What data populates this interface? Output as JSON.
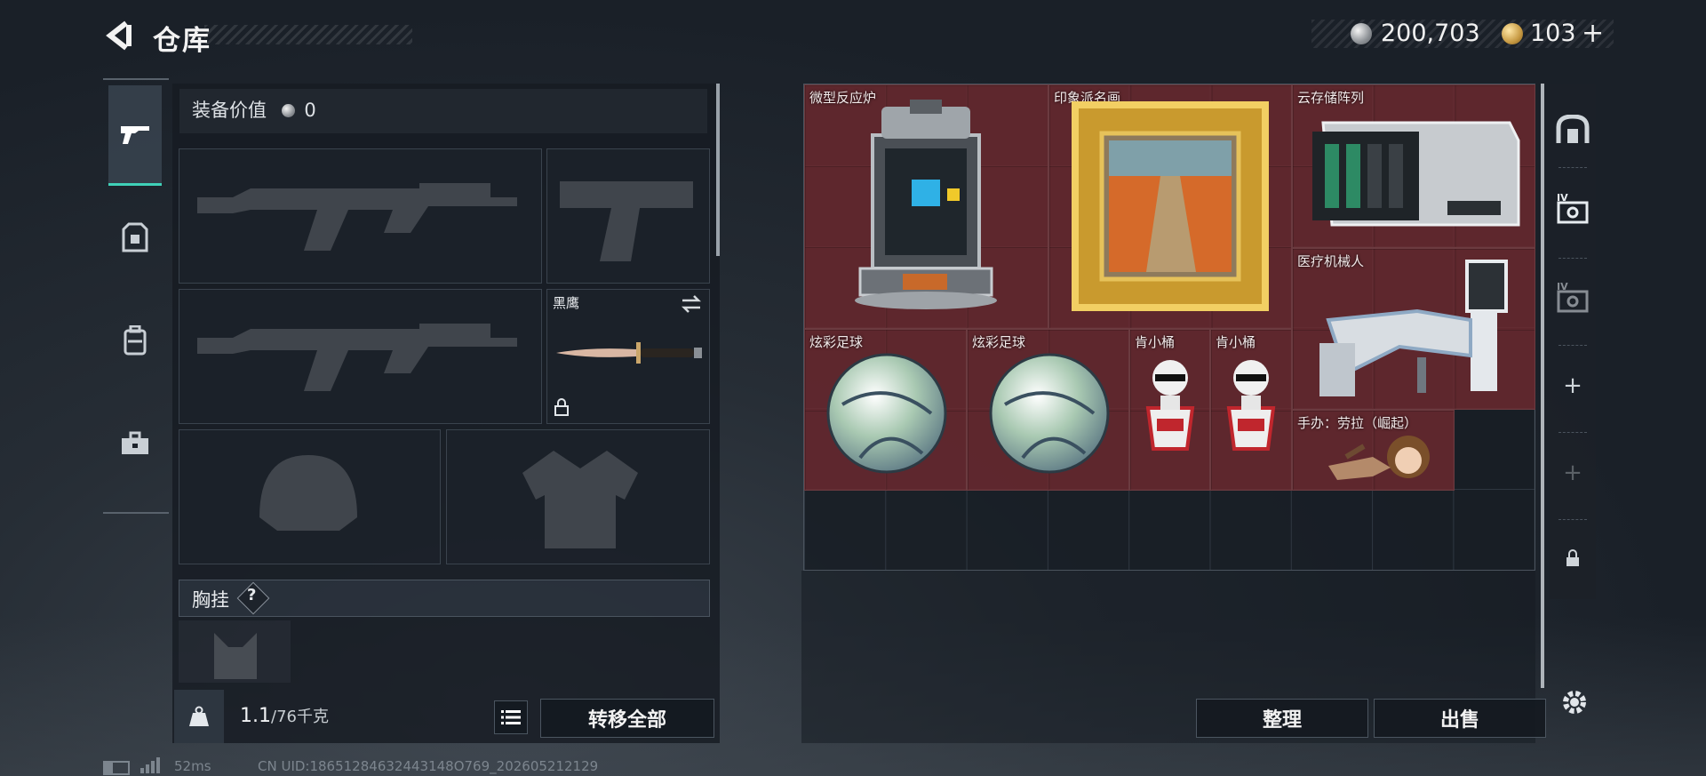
{
  "header": {
    "title": "仓库",
    "silver_amount": "200,703",
    "gold_amount": "103",
    "gold_add": "+"
  },
  "left_tabs": [
    {
      "icon": "gun-icon"
    },
    {
      "icon": "armor-icon"
    },
    {
      "icon": "backpack-icon"
    },
    {
      "icon": "toolbox-icon"
    }
  ],
  "equipment": {
    "value_label": "装备价值",
    "value_amount": "0",
    "melee_name": "黑鹰",
    "chest_rig_label": "胸挂",
    "chest_rig_help": "?",
    "weight_current": "1.1",
    "weight_max": "/76千克",
    "transfer_all_label": "转移全部"
  },
  "inventory": {
    "items": [
      {
        "name": "微型反应炉"
      },
      {
        "name": "印象派名画"
      },
      {
        "name": "云存储阵列"
      },
      {
        "name": "医疗机械人"
      },
      {
        "name": "炫彩足球"
      },
      {
        "name": "炫彩足球"
      },
      {
        "name": "肯小桶"
      },
      {
        "name": "肯小桶"
      },
      {
        "name": "手办：劳拉（崛起）"
      }
    ],
    "sort_label": "整理",
    "sell_label": "出售",
    "right_tabs": [
      {
        "icon": "safe-icon"
      },
      {
        "icon": "container-iv-icon"
      },
      {
        "icon": "container-iv-icon"
      },
      {
        "icon": "plus-icon"
      },
      {
        "icon": "plus-icon"
      },
      {
        "icon": "lock-icon"
      }
    ]
  },
  "footer": {
    "ping": "52ms",
    "uid": "CN UID:18651284632443148O769_202605212129"
  },
  "colors": {
    "accent": "#3fd1b8",
    "item_bg": "#6e2a30",
    "panel_bg": "#161b22"
  }
}
